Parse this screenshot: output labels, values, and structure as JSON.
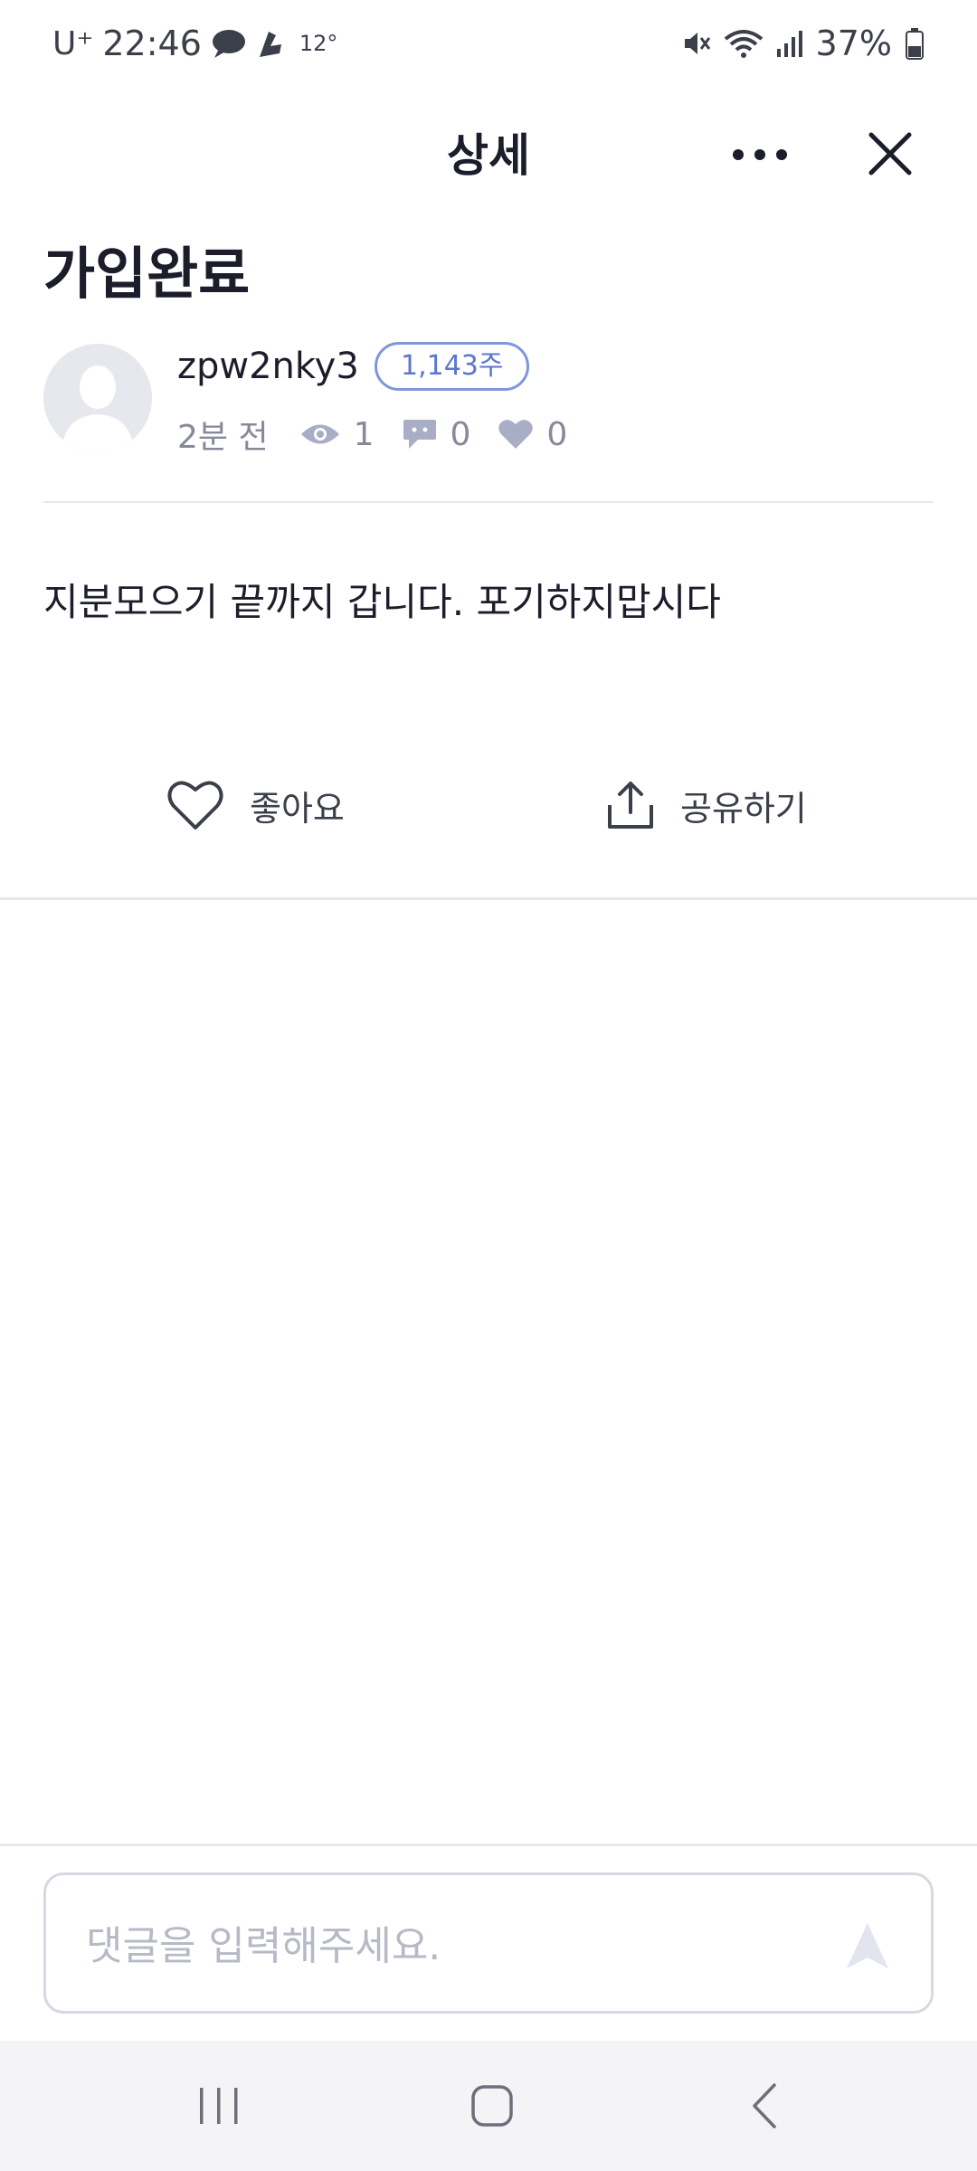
{
  "status_bar": {
    "carrier": "U⁺",
    "time": "22:46",
    "temperature": "12°",
    "battery": "37%"
  },
  "header": {
    "title": "상세"
  },
  "post": {
    "title": "가입완료",
    "author": "zpw2nky3",
    "badge": "1,143주",
    "time": "2분 전",
    "views": "1",
    "comments": "0",
    "likes": "0",
    "body": "지분모으기 끝까지 갑니다. 포기하지맙시다"
  },
  "actions": {
    "like_label": "좋아요",
    "share_label": "공유하기"
  },
  "comment": {
    "placeholder": "댓글을 입력해주세요.",
    "value": ""
  },
  "colors": {
    "badge_accent": "#5b76cf",
    "text_primary": "#1b1d2b",
    "text_secondary": "#868a98",
    "icon_muted": "#a9adc6"
  },
  "icons": {
    "more": "more-dots-icon",
    "close": "close-icon",
    "views": "eye-icon",
    "comments": "chat-bubble-icon",
    "likes": "heart-icon",
    "like_action": "heart-outline-icon",
    "share_action": "share-icon",
    "send": "send-icon"
  }
}
